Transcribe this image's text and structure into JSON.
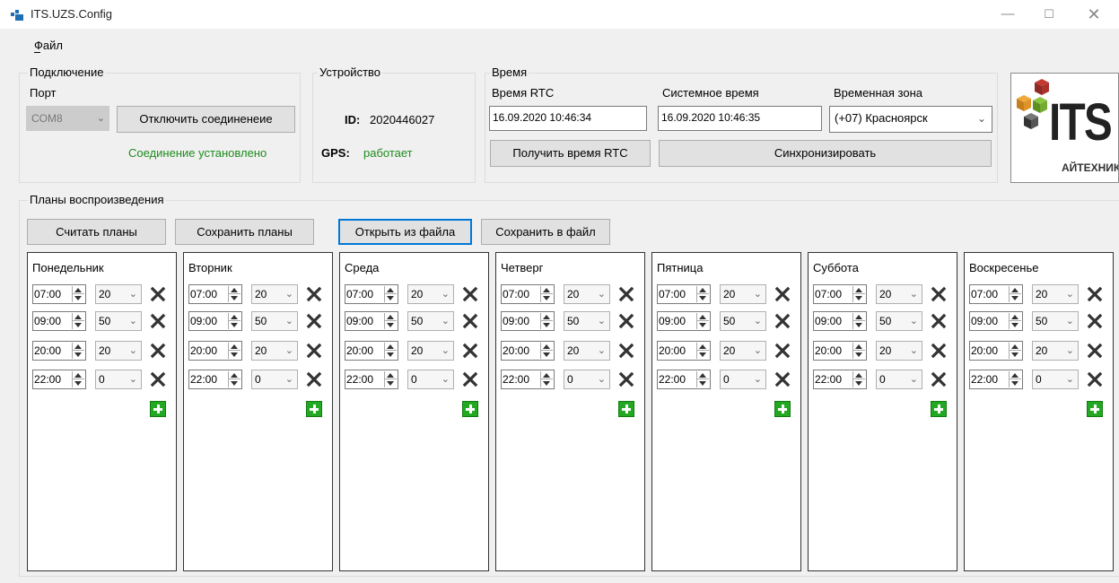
{
  "window": {
    "title": "ITS.UZS.Config"
  },
  "menu": {
    "file": "Файл"
  },
  "connection": {
    "group_title": "Подключение",
    "port_label": "Порт",
    "port_value": "COM8",
    "disconnect_button": "Отключить соединенеие",
    "status_text": "Соединение установлено"
  },
  "device": {
    "group_title": "Устройство",
    "id_label": "ID:",
    "id_value": "2020446027",
    "gps_label": "GPS:",
    "gps_value": "работает"
  },
  "time": {
    "group_title": "Время",
    "rtc_label": "Время RTC",
    "rtc_value": "16.09.2020 10:46:34",
    "system_label": "Системное время",
    "system_value": "16.09.2020 10:46:35",
    "tz_label": "Временная зона",
    "tz_value": "(+07) Красноярск",
    "get_rtc_button": "Получить время RTC",
    "sync_button": "Синхронизировать"
  },
  "logo": {
    "text": "ITS",
    "subtext": "АЙТЕХНИКС"
  },
  "plans": {
    "group_title": "Планы воспроизведения",
    "buttons": {
      "read": "Считать планы",
      "save": "Сохранить планы",
      "open_file": "Открыть из файла",
      "save_file": "Сохранить в файл"
    },
    "days": [
      {
        "name": "Понедельник",
        "entries": [
          {
            "time": "07:00",
            "value": "20"
          },
          {
            "time": "09:00",
            "value": "50"
          },
          {
            "time": "20:00",
            "value": "20"
          },
          {
            "time": "22:00",
            "value": "0"
          }
        ]
      },
      {
        "name": "Вторник",
        "entries": [
          {
            "time": "07:00",
            "value": "20"
          },
          {
            "time": "09:00",
            "value": "50"
          },
          {
            "time": "20:00",
            "value": "20"
          },
          {
            "time": "22:00",
            "value": "0"
          }
        ]
      },
      {
        "name": "Среда",
        "entries": [
          {
            "time": "07:00",
            "value": "20"
          },
          {
            "time": "09:00",
            "value": "50"
          },
          {
            "time": "20:00",
            "value": "20"
          },
          {
            "time": "22:00",
            "value": "0"
          }
        ]
      },
      {
        "name": "Четверг",
        "entries": [
          {
            "time": "07:00",
            "value": "20"
          },
          {
            "time": "09:00",
            "value": "50"
          },
          {
            "time": "20:00",
            "value": "20"
          },
          {
            "time": "22:00",
            "value": "0"
          }
        ]
      },
      {
        "name": "Пятница",
        "entries": [
          {
            "time": "07:00",
            "value": "20"
          },
          {
            "time": "09:00",
            "value": "50"
          },
          {
            "time": "20:00",
            "value": "20"
          },
          {
            "time": "22:00",
            "value": "0"
          }
        ]
      },
      {
        "name": "Суббота",
        "entries": [
          {
            "time": "07:00",
            "value": "20"
          },
          {
            "time": "09:00",
            "value": "50"
          },
          {
            "time": "20:00",
            "value": "20"
          },
          {
            "time": "22:00",
            "value": "0"
          }
        ]
      },
      {
        "name": "Воскресенье",
        "entries": [
          {
            "time": "07:00",
            "value": "20"
          },
          {
            "time": "09:00",
            "value": "50"
          },
          {
            "time": "20:00",
            "value": "20"
          },
          {
            "time": "22:00",
            "value": "0"
          }
        ]
      }
    ]
  },
  "colors": {
    "status_green": "#1e8c1e",
    "add_green": "#22a822",
    "focus_blue": "#0078d7",
    "window_bg": "#f0f0f0"
  }
}
